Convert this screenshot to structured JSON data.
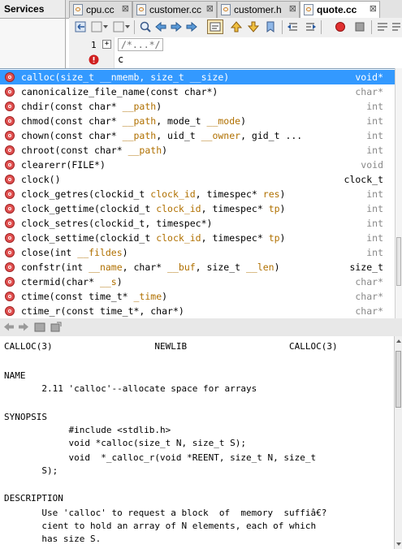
{
  "services_title": "Services",
  "tabs": [
    {
      "label": "cpu.cc",
      "close": "⊠"
    },
    {
      "label": "customer.cc",
      "close": "⊠"
    },
    {
      "label": "customer.h",
      "close": "⊠"
    },
    {
      "label": "quote.cc",
      "close": "⊠"
    }
  ],
  "editor": {
    "line1_number": "1",
    "line1_fold": "+",
    "line1_text": "/*...*/",
    "line2_text": "c"
  },
  "completion": {
    "items": [
      {
        "name": "calloc",
        "open": "(",
        "parts": [
          [
            "size_t ",
            "p"
          ],
          [
            "__nmemb",
            "n"
          ],
          [
            ", size_t ",
            "p"
          ],
          [
            "__size",
            "n"
          ],
          [
            ")",
            "p"
          ]
        ],
        "ret": "void*",
        "ret_grey": false
      },
      {
        "name": "canonicalize_file_name",
        "open": "(",
        "parts": [
          [
            "const char*)",
            "p"
          ]
        ],
        "ret": "char*",
        "ret_grey": true
      },
      {
        "name": "chdir",
        "open": "(",
        "parts": [
          [
            "const char* ",
            "p"
          ],
          [
            "__path",
            "n"
          ],
          [
            ")",
            "p"
          ]
        ],
        "ret": "int",
        "ret_grey": true
      },
      {
        "name": "chmod",
        "open": "(",
        "parts": [
          [
            "const char* ",
            "p"
          ],
          [
            "__path",
            "n"
          ],
          [
            ", mode_t ",
            "p"
          ],
          [
            "__mode",
            "n"
          ],
          [
            ")",
            "p"
          ]
        ],
        "ret": "int",
        "ret_grey": true
      },
      {
        "name": "chown",
        "open": "(",
        "parts": [
          [
            "const char* ",
            "p"
          ],
          [
            "__path",
            "n"
          ],
          [
            ", uid_t ",
            "p"
          ],
          [
            "__owner",
            "n"
          ],
          [
            ", gid_t ...",
            "p"
          ]
        ],
        "ret": "int",
        "ret_grey": true
      },
      {
        "name": "chroot",
        "open": "(",
        "parts": [
          [
            "const char* ",
            "p"
          ],
          [
            "__path",
            "n"
          ],
          [
            ")",
            "p"
          ]
        ],
        "ret": "int",
        "ret_grey": true
      },
      {
        "name": "clearerr",
        "open": "(",
        "parts": [
          [
            "FILE*)",
            "p"
          ]
        ],
        "ret": "void",
        "ret_grey": true
      },
      {
        "name": "clock",
        "open": "(",
        "parts": [
          [
            ")",
            "p"
          ]
        ],
        "ret": "clock_t",
        "ret_grey": false
      },
      {
        "name": "clock_getres",
        "open": "(",
        "parts": [
          [
            "clockid_t ",
            "p"
          ],
          [
            "clock_id",
            "n"
          ],
          [
            ", timespec* ",
            "p"
          ],
          [
            "res",
            "n"
          ],
          [
            ")",
            "p"
          ]
        ],
        "ret": "int",
        "ret_grey": true
      },
      {
        "name": "clock_gettime",
        "open": "(",
        "parts": [
          [
            "clockid_t ",
            "p"
          ],
          [
            "clock_id",
            "n"
          ],
          [
            ", timespec* ",
            "p"
          ],
          [
            "tp",
            "n"
          ],
          [
            ")",
            "p"
          ]
        ],
        "ret": "int",
        "ret_grey": true
      },
      {
        "name": "clock_setres",
        "open": "(",
        "parts": [
          [
            "clockid_t, timespec*)",
            "p"
          ]
        ],
        "ret": "int",
        "ret_grey": true
      },
      {
        "name": "clock_settime",
        "open": "(",
        "parts": [
          [
            "clockid_t ",
            "p"
          ],
          [
            "clock_id",
            "n"
          ],
          [
            ", timespec* ",
            "p"
          ],
          [
            "tp",
            "n"
          ],
          [
            ")",
            "p"
          ]
        ],
        "ret": "int",
        "ret_grey": true
      },
      {
        "name": "close",
        "open": "(",
        "parts": [
          [
            "int ",
            "p"
          ],
          [
            "__fildes",
            "n"
          ],
          [
            ")",
            "p"
          ]
        ],
        "ret": "int",
        "ret_grey": true
      },
      {
        "name": "confstr",
        "open": "(",
        "parts": [
          [
            "int ",
            "p"
          ],
          [
            "__name",
            "n"
          ],
          [
            ", char* ",
            "p"
          ],
          [
            "__buf",
            "n"
          ],
          [
            ", size_t ",
            "p"
          ],
          [
            "__len",
            "n"
          ],
          [
            ")",
            "p"
          ]
        ],
        "ret": "size_t",
        "ret_grey": false
      },
      {
        "name": "ctermid",
        "open": "(",
        "parts": [
          [
            "char* ",
            "p"
          ],
          [
            "__s",
            "n"
          ],
          [
            ")",
            "p"
          ]
        ],
        "ret": "char*",
        "ret_grey": true
      },
      {
        "name": "ctime",
        "open": "(",
        "parts": [
          [
            "const time_t* ",
            "p"
          ],
          [
            "_time",
            "n"
          ],
          [
            ")",
            "p"
          ]
        ],
        "ret": "char*",
        "ret_grey": true
      },
      {
        "name": "ctime_r",
        "open": "(",
        "parts": [
          [
            "const time_t*, char*)",
            "p"
          ]
        ],
        "ret": "char*",
        "ret_grey": true
      }
    ]
  },
  "doc": {
    "lines": [
      "CALLOC(3)                   NEWLIB                   CALLOC(3)",
      "",
      "",
      "NAME",
      "       2.11 'calloc'--allocate space for arrays",
      "",
      "",
      "SYNOPSIS",
      "            #include <stdlib.h>",
      "            void *calloc(size_t N, size_t S);",
      "            void  *_calloc_r(void *REENT, size_t N, size_t",
      "       S);",
      "",
      "DESCRIPTION",
      "       Use 'calloc' to request a block  of  memory  suffiâ€?",
      "       cient to hold an array of N elements, each of which",
      "       has size S."
    ]
  }
}
